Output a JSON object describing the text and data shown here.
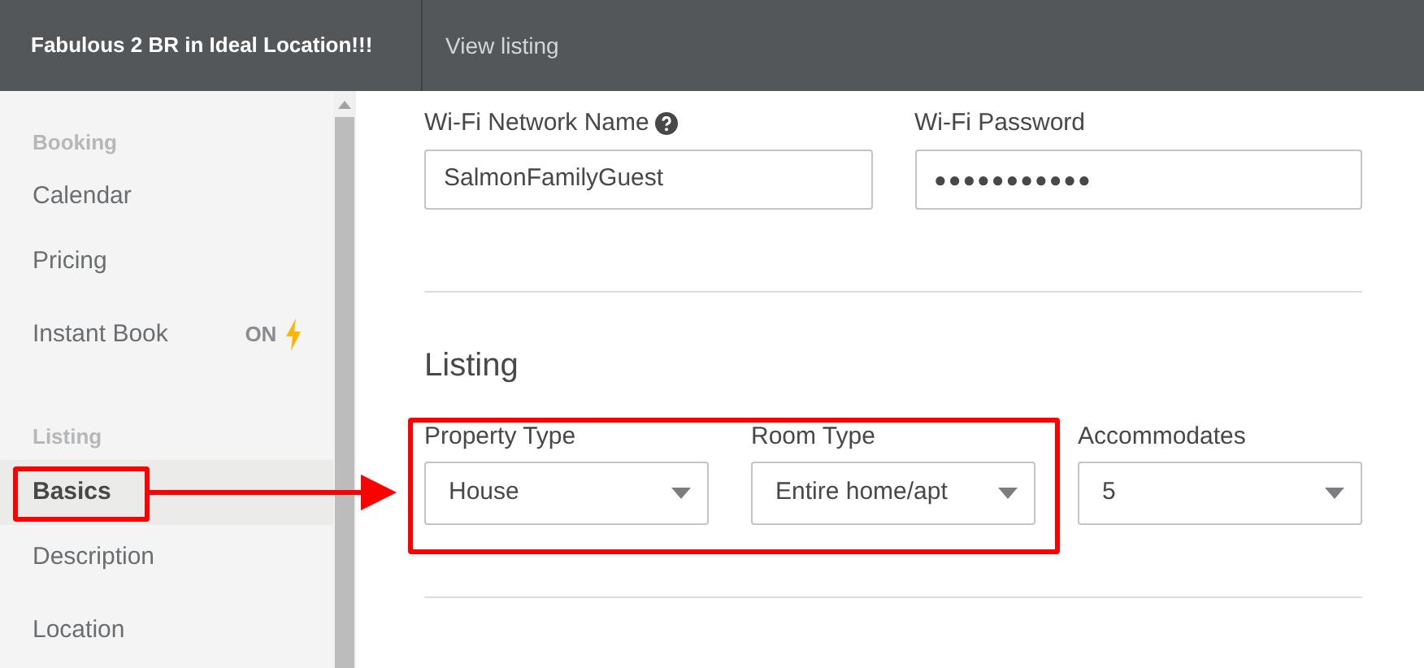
{
  "header": {
    "title": "Fabulous 2 BR in Ideal Location!!!",
    "link": "View listing"
  },
  "sidebar": {
    "sections": [
      {
        "heading": "Booking",
        "items": [
          {
            "label": "Calendar",
            "selected": false
          },
          {
            "label": "Pricing",
            "selected": false
          },
          {
            "label": "Instant Book",
            "selected": false,
            "badge": "ON"
          }
        ]
      },
      {
        "heading": "Listing",
        "items": [
          {
            "label": "Basics",
            "selected": true
          },
          {
            "label": "Description",
            "selected": false
          },
          {
            "label": "Location",
            "selected": false
          }
        ]
      }
    ]
  },
  "wifi": {
    "fields": [
      {
        "label": "Wi-Fi Network Name",
        "help": true,
        "value": "SalmonFamilyGuest"
      },
      {
        "label": "Wi-Fi Password",
        "value": "●●●●●●●●●●●"
      }
    ]
  },
  "listing": {
    "heading": "Listing",
    "selects": [
      {
        "label": "Property Type",
        "value": "House"
      },
      {
        "label": "Room Type",
        "value": "Entire home/apt"
      },
      {
        "label": "Accommodates",
        "value": "5"
      }
    ]
  }
}
